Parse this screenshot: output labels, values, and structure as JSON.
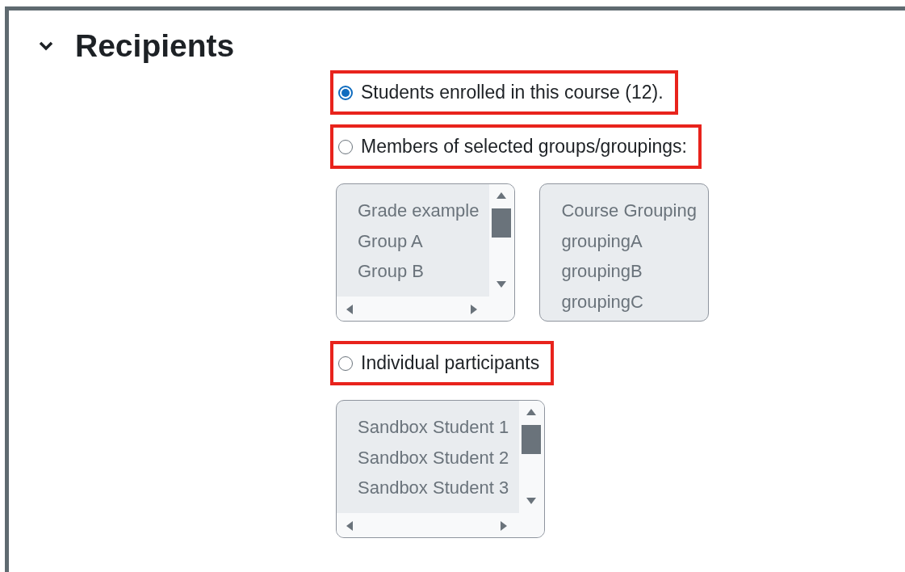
{
  "section": {
    "title": "Recipients",
    "expanded": true
  },
  "options": [
    {
      "label": "Students enrolled in this course (12).",
      "selected": true,
      "highlighted": true
    },
    {
      "label": "Members of selected groups/groupings:",
      "selected": false,
      "highlighted": true,
      "lists": [
        {
          "kind": "scrolling",
          "disabled": true,
          "items": [
            "Grade example",
            "Group A",
            "Group B"
          ]
        },
        {
          "kind": "plain",
          "disabled": true,
          "items": [
            "Course Grouping",
            "groupingA",
            "groupingB",
            "groupingC"
          ]
        }
      ]
    },
    {
      "label": "Individual participants",
      "selected": false,
      "highlighted": true,
      "lists": [
        {
          "kind": "scrolling",
          "disabled": true,
          "items": [
            "Sandbox Student 1",
            "Sandbox Student 2",
            "Sandbox Student 3"
          ]
        }
      ]
    }
  ]
}
